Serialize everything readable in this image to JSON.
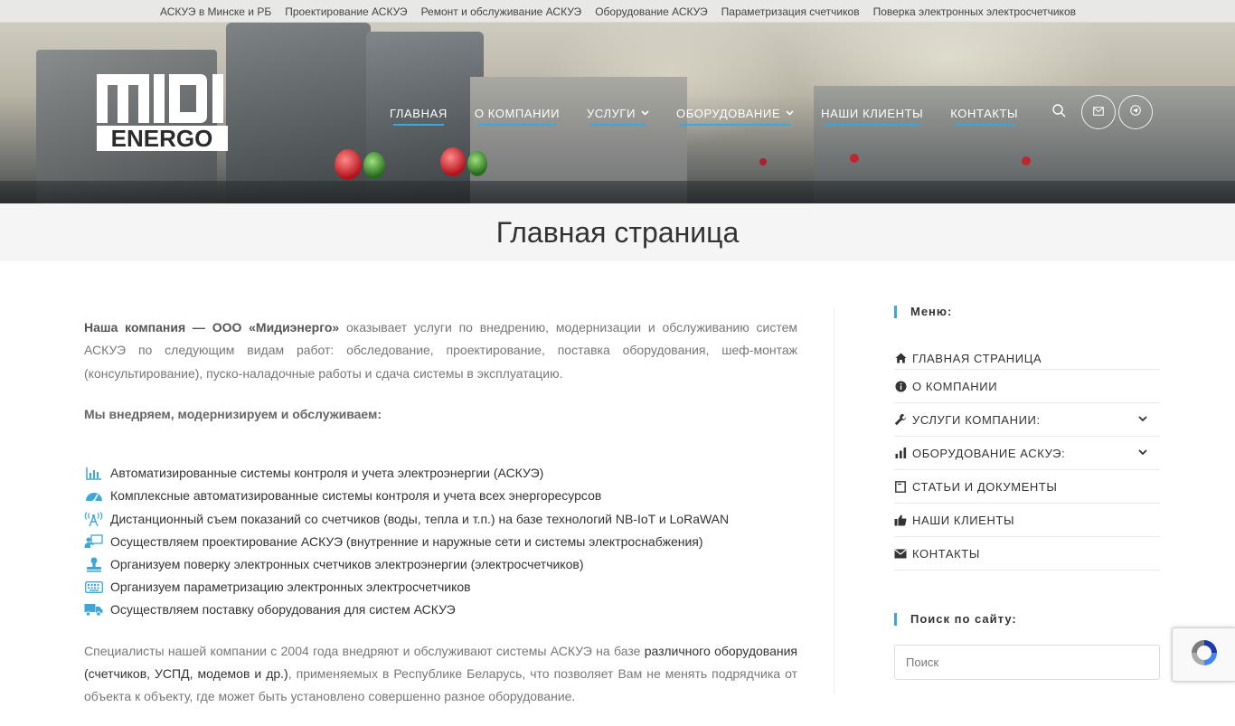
{
  "topbar": {
    "links": [
      "АСКУЭ в Минске и РБ",
      "Проектирование АСКУЭ",
      "Ремонт и обслуживание АСКУЭ",
      "Оборудование АСКУЭ",
      "Параметризация счетчиков",
      "Поверка электронных электросчетчиков"
    ]
  },
  "logo": {
    "line1": "MIDI",
    "line2": "ENERGO"
  },
  "nav": {
    "home": "Главная",
    "about": "О компании",
    "services": "Услуги",
    "equipment": "Оборудование",
    "clients": "Наши клиенты",
    "contacts": "Контакты"
  },
  "page": {
    "title": "Главная страница"
  },
  "content": {
    "intro_bold": "Наша компания — ООО «Мидиэнерго»",
    "intro_rest": " оказывает услуги по внедрению, модернизации и обслуживанию систем АСКУЭ по следующим видам работ: обследование, проектирование, поставка оборудования, шеф-монтаж (консультирование), пуско-наладочные работы и сдача системы в эксплуатацию.",
    "subheading": "Мы внедряем, модернизируем и обслуживаем:",
    "features": [
      {
        "icon": "bar-chart-icon",
        "text": "Автоматизированные системы контроля и учета электроэнергии (АСКУЭ)"
      },
      {
        "icon": "gauge-icon",
        "text": "Комплексные автоматизированные системы контроля и учета всех энергоресурсов"
      },
      {
        "icon": "antenna-icon",
        "text": "Дистанционный съем показаний со счетчиков (воды, тепла и т.п.) на базе технологий NB-IoT и LoRaWAN"
      },
      {
        "icon": "engineer-icon",
        "text": "Осуществляем проектирование АСКУЭ (внутренние и наружные сети и системы электроснабжения)"
      },
      {
        "icon": "stamp-icon",
        "text": "Организуем поверку электронных счетчиков электроэнергии (электросчетчиков)"
      },
      {
        "icon": "keyboard-icon",
        "text": "Организуем параметризацию электронных электросчетчиков"
      },
      {
        "icon": "truck-icon",
        "text": "Осуществляем поставку оборудования для систем АСКУЭ"
      }
    ],
    "closing_start": "Специалисты нашей компании с 2004 года внедряют и обслуживают системы АСКУЭ на базе ",
    "closing_link": "различного оборудования (счетчиков, УСПД, модемов и др.)",
    "closing_rest": ", применяемых в Республике Беларусь, что позволяет Вам не менять подрядчика от объекта к объекту, где может быть установлено совершенно разное оборудование."
  },
  "sidebar": {
    "menu_title": "Меню:",
    "menu": [
      {
        "label": "Главная страница",
        "icon": "home-icon"
      },
      {
        "label": "О компании",
        "icon": "info-icon"
      },
      {
        "label": "Услуги компании:",
        "icon": "wrench-icon"
      },
      {
        "label": "Оборудование АСКУЭ:",
        "icon": "signal-bars-icon"
      },
      {
        "label": "Статьи и документы",
        "icon": "document-icon"
      },
      {
        "label": "Наши клиенты",
        "icon": "thumbs-up-icon"
      },
      {
        "label": "Контакты",
        "icon": "envelope-icon"
      }
    ],
    "search_title": "Поиск по сайту:",
    "search_placeholder": "Поиск"
  },
  "colors": {
    "accent": "#3fa7d6",
    "text_dark": "#333333",
    "text_muted": "#777777"
  }
}
